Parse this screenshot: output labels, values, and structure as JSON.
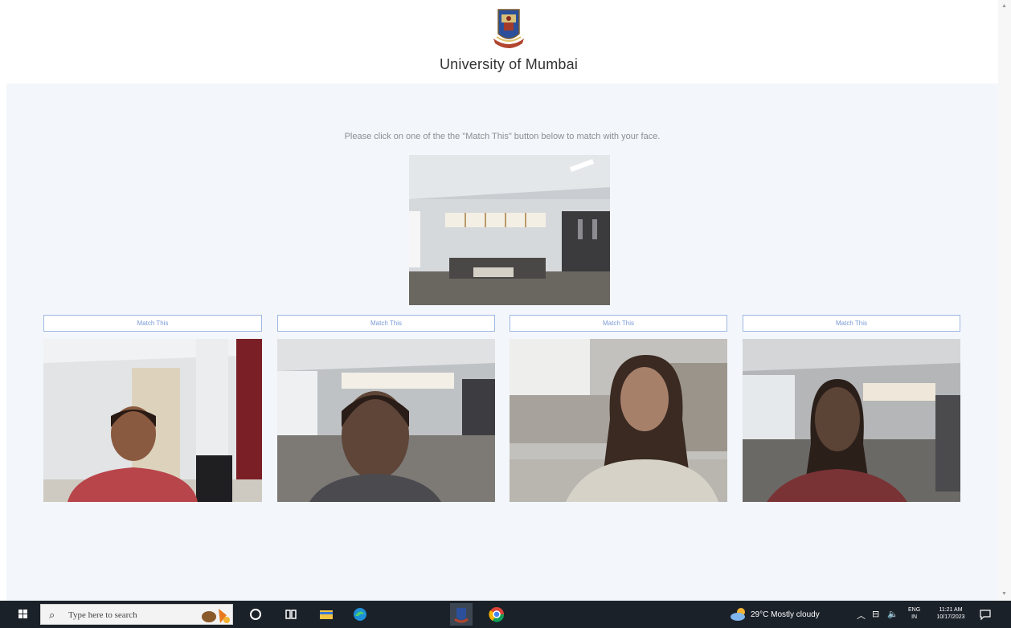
{
  "header": {
    "title": "University of Mumbai"
  },
  "main": {
    "instruction": "Please click on one of the the \"Match This\" button below to match with your face.",
    "candidates": [
      {
        "button_label": "Match This"
      },
      {
        "button_label": "Match This"
      },
      {
        "button_label": "Match This"
      },
      {
        "button_label": "Match This"
      }
    ]
  },
  "taskbar": {
    "search_placeholder": "Type here to search",
    "weather": "29°C  Mostly cloudy",
    "language": [
      "ENG",
      "IN"
    ],
    "clock": [
      "11:21 AM",
      "10/17/2023"
    ],
    "accent_color": "#1b2129"
  },
  "colors": {
    "page_bg": "#f3f6fa",
    "button_border": "#9fb8e3",
    "button_text": "#7a9ad6"
  }
}
